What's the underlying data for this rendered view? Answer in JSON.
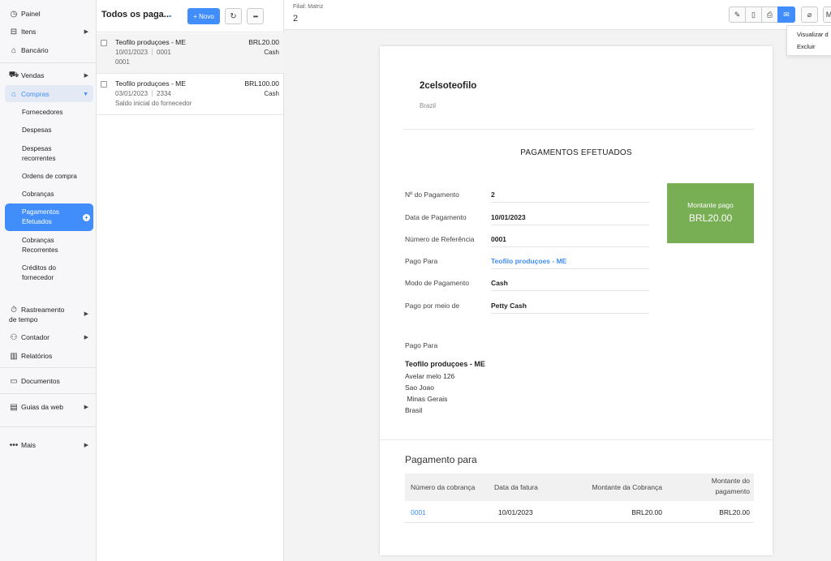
{
  "sidebar": {
    "items": [
      {
        "label": "Painel",
        "icon": "dashboard-icon"
      },
      {
        "label": "Itens",
        "icon": "basket-icon"
      },
      {
        "label": "Bancário",
        "icon": "bank-icon"
      },
      {
        "label": "Vendas",
        "icon": "cart-icon"
      },
      {
        "label": "Compras",
        "icon": "bag-icon"
      },
      {
        "label": "Rastreamento de tempo",
        "icon": "timer-icon"
      },
      {
        "label": "Contador",
        "icon": "accountant-icon"
      },
      {
        "label": "Relatórios",
        "icon": "reports-icon"
      },
      {
        "label": "Documentos",
        "icon": "folder-icon"
      },
      {
        "label": "Guias da web",
        "icon": "web-tabs-icon"
      },
      {
        "label": "Mais",
        "icon": "more-icon"
      }
    ],
    "compras_sub": [
      {
        "label": "Fornecedores"
      },
      {
        "label": "Despesas"
      },
      {
        "label": "Despesas recorrentes"
      },
      {
        "label": "Ordens de compra"
      },
      {
        "label": "Cobranças"
      },
      {
        "label": "Pagamentos Efetuados"
      },
      {
        "label": "Cobranças Recorrentes"
      },
      {
        "label": "Créditos do fornecedor"
      }
    ]
  },
  "list": {
    "title": "Todos os paga...",
    "new_label": "+ Novo",
    "rows": [
      {
        "name": "Teofilo produçoes - ME",
        "amount": "BRL20.00",
        "date": "10/01/2023",
        "ref": "0001",
        "line3": "0001",
        "mode": "Cash"
      },
      {
        "name": "Teofilo produçoes - ME",
        "amount": "BRL100.00",
        "date": "03/01/2023",
        "ref": "2334",
        "line3": "Saldo inicial do fornecedor",
        "mode": "Cash"
      }
    ]
  },
  "detail": {
    "filial": "Filial: Matriz",
    "number": "2",
    "toolbar_more": "M",
    "dropdown": [
      "Visualizar d",
      "Excluir"
    ]
  },
  "doc": {
    "org": "2celsoteofilo",
    "country": "Brazil",
    "title": "PAGAMENTOS EFETUADOS",
    "fields": [
      {
        "label": "Nº do Pagamento",
        "value": "2"
      },
      {
        "label": "Data de Pagamento",
        "value": "10/01/2023"
      },
      {
        "label": "Número de Referência",
        "value": "0001"
      },
      {
        "label": "Pago Para",
        "value": "Teofilo produçoes - ME"
      },
      {
        "label": "Modo de Pagamento",
        "value": "Cash"
      },
      {
        "label": "Pago por meio de",
        "value": "Petty Cash"
      }
    ],
    "amount_label": "Montante pago",
    "amount_value": "BRL20.00",
    "paid_to_label": "Pago Para",
    "paid_to_name": "Teofilo produçoes - ME",
    "address": [
      "Avelar melo 126",
      "Sao Joao",
      " Minas Gerais",
      "Brasil"
    ],
    "section_title": "Pagamento para",
    "table_headers": [
      "Número da cobrança",
      "Data da fatura",
      "Montante da Cobrança",
      "Montante do pagamento"
    ],
    "table_rows": [
      {
        "bill": "0001",
        "date": "10/01/2023",
        "bill_amount": "BRL20.00",
        "paid_amount": "BRL20.00"
      }
    ]
  },
  "colors": {
    "accent": "#408dfb",
    "amount_box": "#78ae54"
  }
}
